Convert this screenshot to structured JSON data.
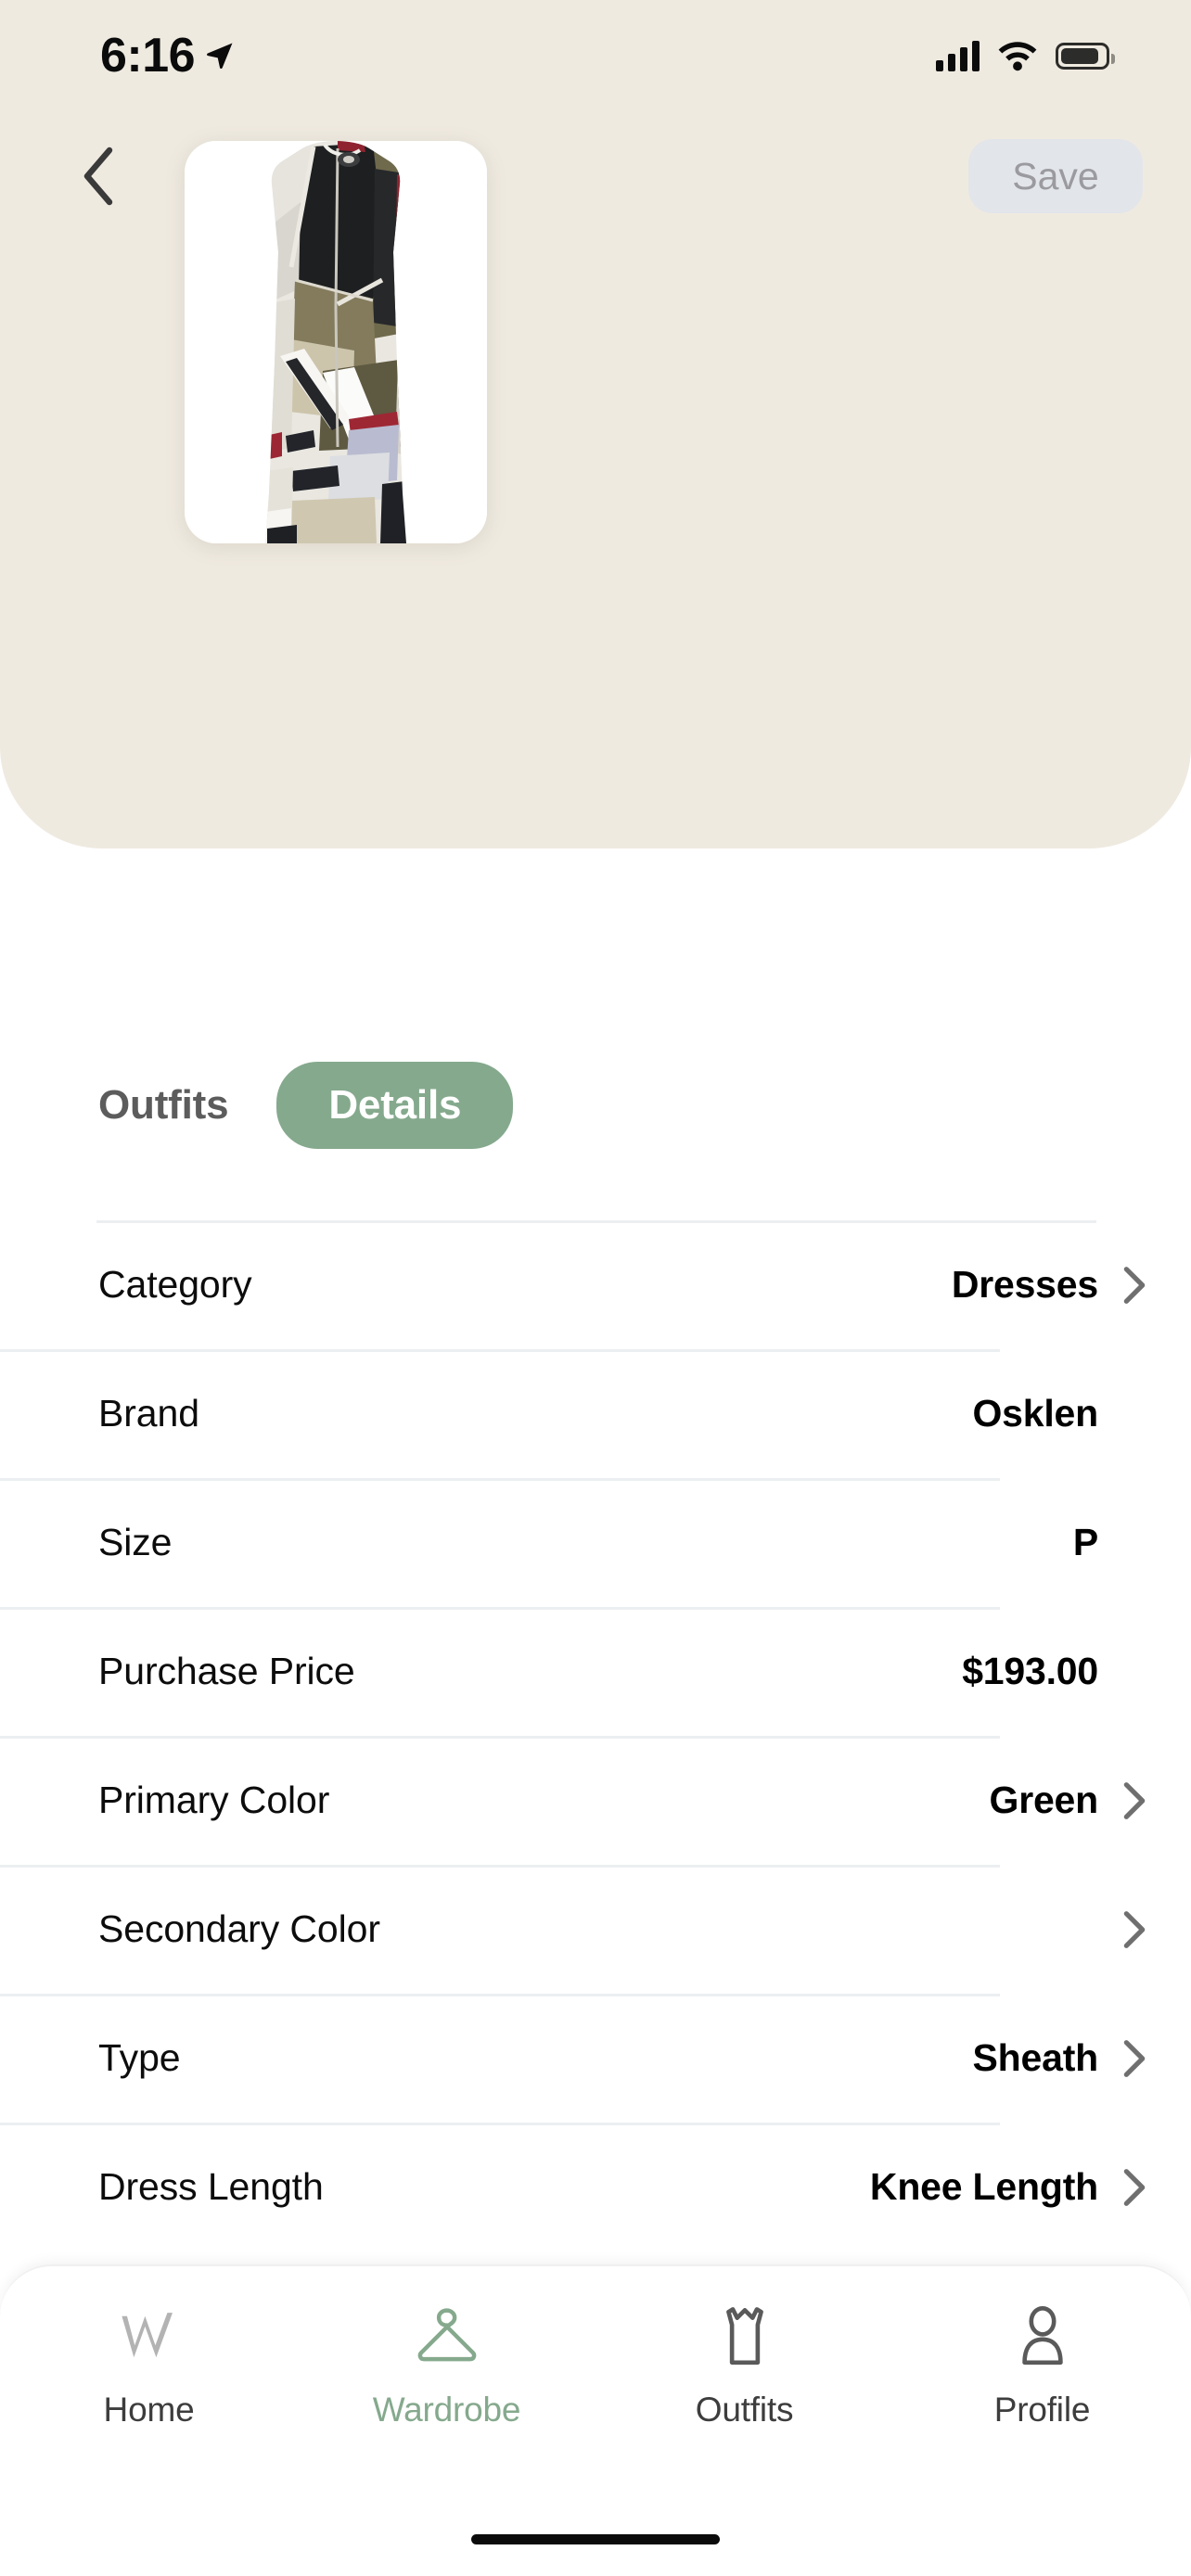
{
  "status_bar": {
    "time": "6:16",
    "location_icon": "location-arrow-icon",
    "cellular_icon": "cellular-bars-icon",
    "wifi_icon": "wifi-icon",
    "battery_icon": "battery-icon"
  },
  "nav": {
    "back_icon": "chevron-left-icon",
    "save_label": "Save",
    "save_enabled": false
  },
  "item": {
    "image_alt": "abstract-print-sheath-dress",
    "card_background": "#ffffff"
  },
  "tabs": {
    "items": [
      {
        "label": "Outfits",
        "active": false
      },
      {
        "label": "Details",
        "active": true
      }
    ],
    "active_color": "#85a98d",
    "inactive_color": "#5c5c5c"
  },
  "details": {
    "rows": [
      {
        "label": "Category",
        "value": "Dresses",
        "chevron": true
      },
      {
        "label": "Brand",
        "value": "Osklen",
        "chevron": false
      },
      {
        "label": "Size",
        "value": "P",
        "chevron": false
      },
      {
        "label": "Purchase Price",
        "value": "$193.00",
        "chevron": false
      },
      {
        "label": "Primary Color",
        "value": "Green",
        "chevron": true
      },
      {
        "label": "Secondary Color",
        "value": "",
        "chevron": true
      },
      {
        "label": "Type",
        "value": "Sheath",
        "chevron": true
      },
      {
        "label": "Dress Length",
        "value": "Knee Length",
        "chevron": true
      }
    ]
  },
  "bottom_nav": {
    "items": [
      {
        "label": "Home",
        "icon": "w-logo-icon",
        "active": false
      },
      {
        "label": "Wardrobe",
        "icon": "hanger-icon",
        "active": true
      },
      {
        "label": "Outfits",
        "icon": "tshirt-icon",
        "active": false
      },
      {
        "label": "Profile",
        "icon": "person-icon",
        "active": false
      }
    ],
    "active_color": "#85a98d",
    "inactive_color": "#3d3d3d"
  },
  "theme": {
    "header_background": "#efeae0",
    "page_background": "#ffffff",
    "accent": "#85a98d",
    "divider": "#eceff1",
    "save_button_bg": "#e2e5ea",
    "save_button_text": "#9a9a9f"
  }
}
